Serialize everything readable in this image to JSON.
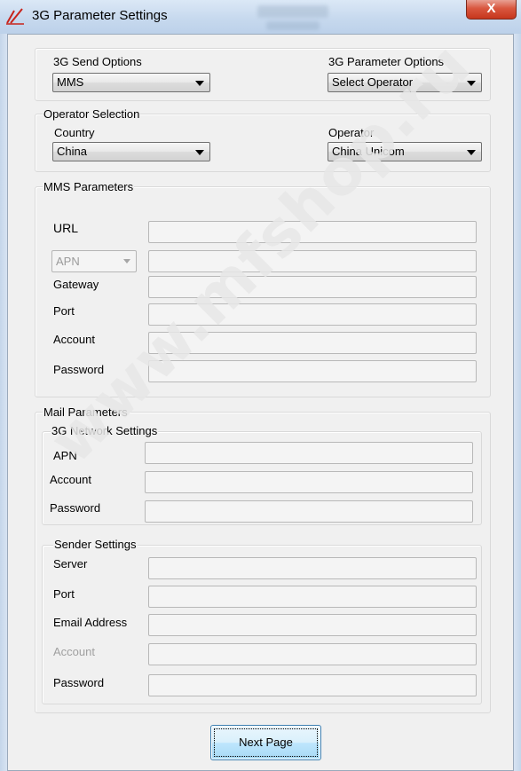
{
  "window": {
    "title": "3G Parameter Settings",
    "close_label": "X"
  },
  "send_options": {
    "label": "3G Send Options",
    "selected": "MMS"
  },
  "parameter_options": {
    "label": "3G Parameter Options",
    "selected": "Select Operator"
  },
  "operator_selection": {
    "legend": "Operator Selection",
    "country_label": "Country",
    "country_selected": "China",
    "operator_label": "Operator",
    "operator_selected": "China Unicom"
  },
  "mms": {
    "legend": "MMS Parameters",
    "url_label": "URL",
    "apn_combo": "APN",
    "gateway_label": "Gateway",
    "port_label": "Port",
    "account_label": "Account",
    "password_label": "Password"
  },
  "mail": {
    "legend": "Mail Parameters",
    "network": {
      "legend": "3G Network Settings",
      "apn_label": "APN",
      "account_label": "Account",
      "password_label": "Password"
    },
    "sender": {
      "legend": "Sender Settings",
      "server_label": "Server",
      "port_label": "Port",
      "email_label": "Email Address",
      "account_label": "Account",
      "password_label": "Password"
    }
  },
  "footer": {
    "next_label": "Next Page"
  },
  "watermark": "www.mfshop.ru",
  "colors": {
    "title_bar": "#c7d9ee",
    "close_button": "#d9573f",
    "button_blue": "#bee6fd",
    "watermark": "#e6e6e6"
  }
}
